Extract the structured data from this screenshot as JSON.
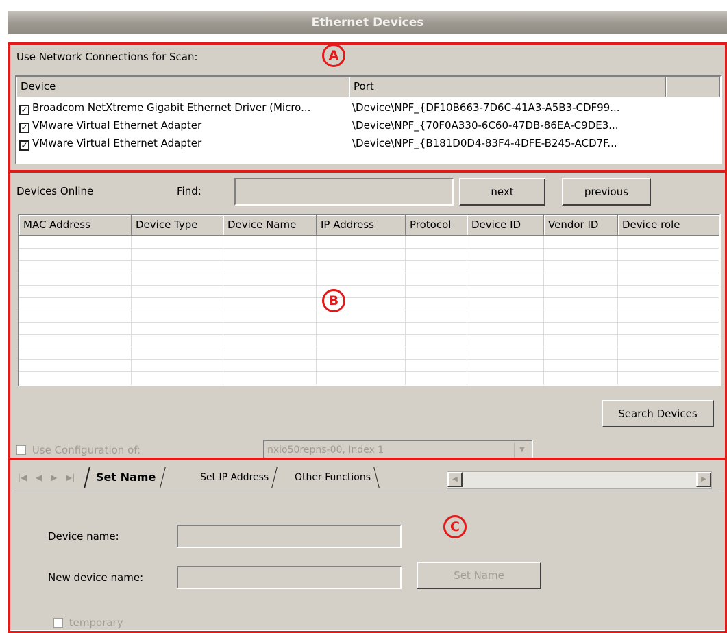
{
  "window": {
    "title": "Ethernet Devices"
  },
  "scan": {
    "label": "Use Network Connections for Scan:",
    "columns": [
      "Device",
      "Port"
    ],
    "rows": [
      {
        "checked": true,
        "device": "Broadcom NetXtreme Gigabit Ethernet Driver (Micro...",
        "port": "\\Device\\NPF_{DF10B663-7D6C-41A3-A5B3-CDF99..."
      },
      {
        "checked": true,
        "device": "VMware Virtual Ethernet Adapter",
        "port": "\\Device\\NPF_{70F0A330-6C60-47DB-86EA-C9DE3..."
      },
      {
        "checked": true,
        "device": "VMware Virtual Ethernet Adapter",
        "port": "\\Device\\NPF_{B181D0D4-83F4-4DFE-B245-ACD7F..."
      }
    ]
  },
  "devices": {
    "label": "Devices Online",
    "find_label": "Find:",
    "find_value": "",
    "next_label": "next",
    "previous_label": "previous",
    "columns": [
      "MAC Address",
      "Device Type",
      "Device Name",
      "IP Address",
      "Protocol",
      "Device ID",
      "Vendor ID",
      "Device role"
    ],
    "search_label": "Search Devices",
    "use_config_label": "Use Configuration of:",
    "use_config_checked": false,
    "config_value": "nxio50repns-00, Index 1"
  },
  "tabs": {
    "items": [
      "Set Name",
      "Set IP Address",
      "Other Functions"
    ],
    "active": "Set Name"
  },
  "set_name": {
    "device_name_label": "Device name:",
    "device_name_value": "",
    "new_device_name_label": "New device name:",
    "new_device_name_value": "",
    "set_name_button": "Set Name",
    "temporary_label": "temporary",
    "temporary_checked": false
  },
  "annotations": {
    "a": "A",
    "b": "B",
    "c": "C"
  },
  "colors": {
    "annotation": "#e21a1a",
    "panel": "#d4d0c8"
  }
}
